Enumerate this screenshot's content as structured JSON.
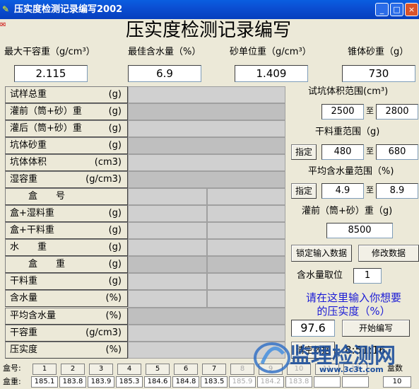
{
  "window": {
    "title": "压实度检测记录编写2002",
    "min": "_",
    "max": "□",
    "close": "×"
  },
  "header": {
    "title": "压实度检测记录编写"
  },
  "top_params": [
    {
      "label": "最大干容重（g/cm³）",
      "value": "2.115"
    },
    {
      "label": "最佳含水量（%）",
      "value": "6.9"
    },
    {
      "label": "砂单位重（g/cm³）",
      "value": "1.409"
    },
    {
      "label": "锥体砂重（g）",
      "value": "730"
    }
  ],
  "rows": [
    {
      "label": "试样总重",
      "unit": "(g)"
    },
    {
      "label": "灌前（筒+砂）重",
      "unit": "(g)"
    },
    {
      "label": "灌后（筒+砂）重",
      "unit": "(g)"
    },
    {
      "label": "坑体砂重",
      "unit": "(g)"
    },
    {
      "label": "坑体体积",
      "unit": "(cm3)"
    },
    {
      "label": "湿容重",
      "unit": "(g/cm3)"
    },
    {
      "label": "　　盒　　号",
      "unit": ""
    },
    {
      "label": "盒+湿料重",
      "unit": "(g)"
    },
    {
      "label": "盒+干料重",
      "unit": "(g)"
    },
    {
      "label": "水　　重",
      "unit": "(g)"
    },
    {
      "label": "　　盒　　重",
      "unit": "(g)"
    },
    {
      "label": "干料重",
      "unit": "(g)"
    },
    {
      "label": "含水量",
      "unit": "(%)"
    },
    {
      "label": "平均含水量",
      "unit": "(%)"
    },
    {
      "label": "干容重",
      "unit": "(g/cm3)"
    },
    {
      "label": "压实度",
      "unit": "(%)"
    }
  ],
  "right": {
    "pit_volume_label": "试坑体积范围(cm³)",
    "pit_volume_min": "2500",
    "pit_volume_max": "2800",
    "to": "至",
    "dry_weight_label": "干料重范围（g)",
    "dry_weight_button": "指定",
    "dry_weight_min": "480",
    "dry_weight_max": "680",
    "avg_moisture_label": "平均含水量范围（%)",
    "avg_moisture_button": "指定",
    "avg_moisture_min": "4.9",
    "avg_moisture_max": "8.9",
    "pre_fill_label": "灌前（筒+砂）重（g)",
    "pre_fill_value": "8500",
    "lock_button": "锁定输入数据",
    "modify_button": "修改数据",
    "moisture_digits_label": "含水量取位",
    "moisture_digits_value": "1",
    "prompt_line1": "请在这里输入你想要",
    "prompt_line2": "的压实度（%）",
    "compaction_value": "97.6",
    "start_button": "开始编写",
    "clear_button": "清空数据",
    "time": "8:51:16"
  },
  "bottom": {
    "box_no_label": "盒号:",
    "box_weight_label": "盒重:",
    "box_numbers": [
      "1",
      "2",
      "3",
      "4",
      "5",
      "6",
      "7",
      "8",
      "9",
      "10",
      "11",
      "12"
    ],
    "box_weights": [
      "185.1",
      "183.8",
      "183.9",
      "185.3",
      "184.6",
      "184.8",
      "183.5",
      "185.9",
      "184.2",
      "183.8",
      "",
      ""
    ],
    "box_count_label": "盒数",
    "box_count_value": "10"
  },
  "watermark": {
    "text": "监理检测网",
    "url": "www.3c3t.com"
  }
}
